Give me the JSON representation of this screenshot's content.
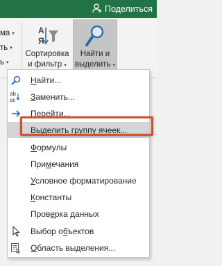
{
  "titlebar": {
    "share_label": "Поделиться",
    "bg_color": "#217346"
  },
  "ribbon": {
    "left_rows": [
      "ма",
      "ть",
      "ь"
    ],
    "sort_filter": {
      "line1": "Сортировка",
      "line2": "и фильтр",
      "icon": "sort-az-filter-icon"
    },
    "find_select": {
      "line1": "Найти и",
      "line2": "выделить",
      "icon": "magnifier-icon"
    }
  },
  "menu": {
    "items": [
      {
        "pre": "",
        "u": "Н",
        "post": "айти...",
        "icon": "search-icon"
      },
      {
        "pre": "",
        "u": "З",
        "post": "аменить...",
        "icon": "replace-ab-ac-icon"
      },
      {
        "pre": "",
        "u": "П",
        "post": "ерейти...",
        "icon": "goto-arrow-icon"
      },
      {
        "pre": "Выделить ",
        "u": "г",
        "post": "руппу ячеек...",
        "icon": ""
      },
      {
        "pre": "",
        "u": "Ф",
        "post": "ормулы",
        "icon": ""
      },
      {
        "pre": "При",
        "u": "м",
        "post": "ечания",
        "icon": ""
      },
      {
        "pre": "",
        "u": "У",
        "post": "словное форматирование",
        "icon": ""
      },
      {
        "pre": "",
        "u": "К",
        "post": "онстанты",
        "icon": ""
      },
      {
        "pre": "Пров",
        "u": "е",
        "post": "рка данных",
        "icon": ""
      },
      {
        "pre": "Выбор о",
        "u": "б",
        "post": "ъектов",
        "icon": "pointer-cursor-icon"
      },
      {
        "pre": "",
        "u": "О",
        "post": "бласть выделения...",
        "icon": "selection-pane-icon"
      }
    ],
    "highlight_color": "#d0502c"
  }
}
